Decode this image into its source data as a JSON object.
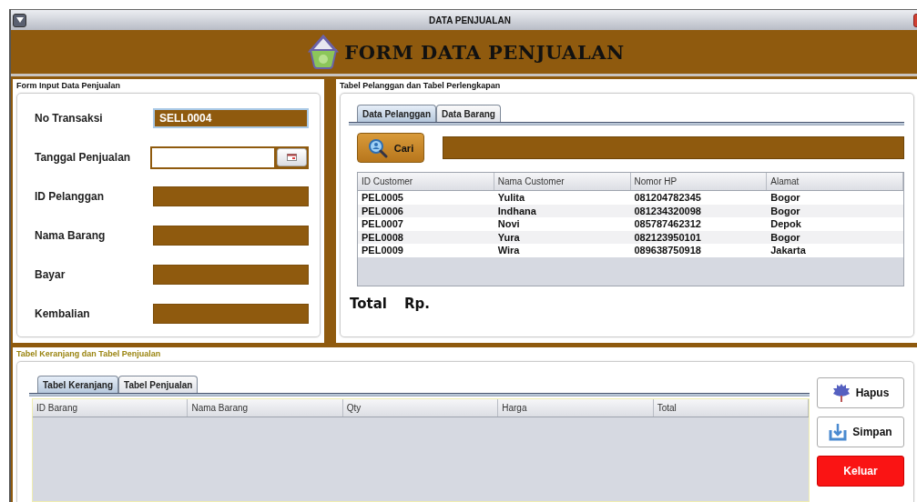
{
  "window": {
    "title": "DATA PENJUALAN"
  },
  "header": {
    "title": "FORM DATA PENJUALAN"
  },
  "form_panel": {
    "title": "Form Input Data Penjualan",
    "fields": [
      {
        "label": "No Transaksi",
        "kind": "text",
        "value": "SELL0004",
        "focused": true
      },
      {
        "label": "Tanggal Penjualan",
        "kind": "date",
        "focused": false
      },
      {
        "label": "ID Pelanggan",
        "kind": "text",
        "focused": false
      },
      {
        "label": "Nama Barang",
        "kind": "text",
        "focused": false
      },
      {
        "label": "Bayar",
        "kind": "text",
        "focused": false
      },
      {
        "label": "Kembalian",
        "kind": "text",
        "focused": false
      }
    ]
  },
  "customer_panel": {
    "title": "Tabel Pelanggan dan Tabel Perlengkapan",
    "tabs": [
      {
        "label": "Data Pelanggan",
        "selected": true
      },
      {
        "label": "Data Barang",
        "selected": false
      }
    ],
    "search_button": "Cari",
    "table": {
      "columns": [
        "ID Customer",
        "Nama Customer",
        "Nomor HP",
        "Alamat"
      ],
      "rows": [
        [
          "PEL0005",
          "Yulita",
          "081204782345",
          "Bogor"
        ],
        [
          "PEL0006",
          "Indhana",
          "081234320098",
          "Bogor"
        ],
        [
          "PEL0007",
          "Novi",
          "085787462312",
          "Depok"
        ],
        [
          "PEL0008",
          "Yura",
          "082123950101",
          "Bogor"
        ],
        [
          "PEL0009",
          "Wira",
          "089638750918",
          "Jakarta"
        ]
      ]
    },
    "total_label": "Total",
    "currency": "Rp."
  },
  "cart_panel": {
    "title": "Tabel Keranjang dan Tabel Penjualan",
    "tabs": [
      {
        "label": "Tabel Keranjang",
        "selected": true
      },
      {
        "label": "Tabel Penjualan",
        "selected": false
      }
    ],
    "table": {
      "columns": [
        "ID Barang",
        "Nama Barang",
        "Qty",
        "Harga",
        "Total"
      ]
    },
    "buttons": [
      {
        "label": "Hapus",
        "kind": "delete"
      },
      {
        "label": "Simpan",
        "kind": "save"
      },
      {
        "label": "Keluar",
        "kind": "exit"
      }
    ]
  }
}
